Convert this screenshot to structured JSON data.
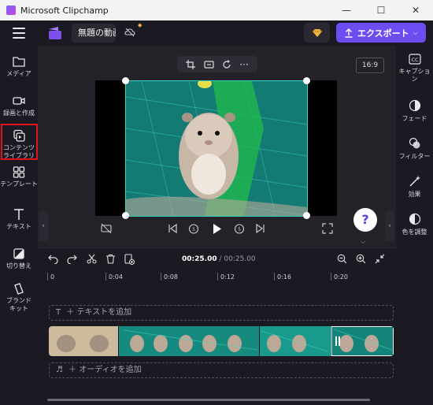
{
  "window": {
    "title": "Microsoft Clipchamp",
    "minimize": "—",
    "maximize": "☐",
    "close": "✕"
  },
  "header": {
    "project_title": "無題の動画",
    "export_label": "エクスポート"
  },
  "left_nav": [
    {
      "label": "メディア",
      "icon": "folder-icon"
    },
    {
      "label": "録画と作成",
      "icon": "camera-icon"
    },
    {
      "label": "コンテンツ\nライブラリ",
      "icon": "content-library-icon"
    },
    {
      "label": "テンプレート",
      "icon": "template-icon"
    },
    {
      "label": "テキスト",
      "icon": "text-icon"
    },
    {
      "label": "切り替え",
      "icon": "transition-icon"
    },
    {
      "label": "ブランド キット",
      "icon": "brand-kit-icon"
    }
  ],
  "right_nav": [
    {
      "label": "キャプション",
      "icon": "captions-icon"
    },
    {
      "label": "フェード",
      "icon": "fade-icon"
    },
    {
      "label": "フィルター",
      "icon": "filter-icon"
    },
    {
      "label": "効果",
      "icon": "effects-icon"
    },
    {
      "label": "色を調整",
      "icon": "color-adjust-icon"
    }
  ],
  "preview": {
    "aspect_ratio": "16:9",
    "help": "?"
  },
  "timeline": {
    "current_time": "00:25.00",
    "separator": " / ",
    "total_time": "00:25.00",
    "ruler": [
      "0",
      "0:04",
      "0:08",
      "0:12",
      "0:16",
      "0:20"
    ],
    "add_text": "＋ テキストを追加",
    "add_audio": "＋ オーディオを追加"
  },
  "colors": {
    "accent": "#6d4cf1",
    "selection": "#38d4c4",
    "highlight_box": "#e0141e"
  }
}
